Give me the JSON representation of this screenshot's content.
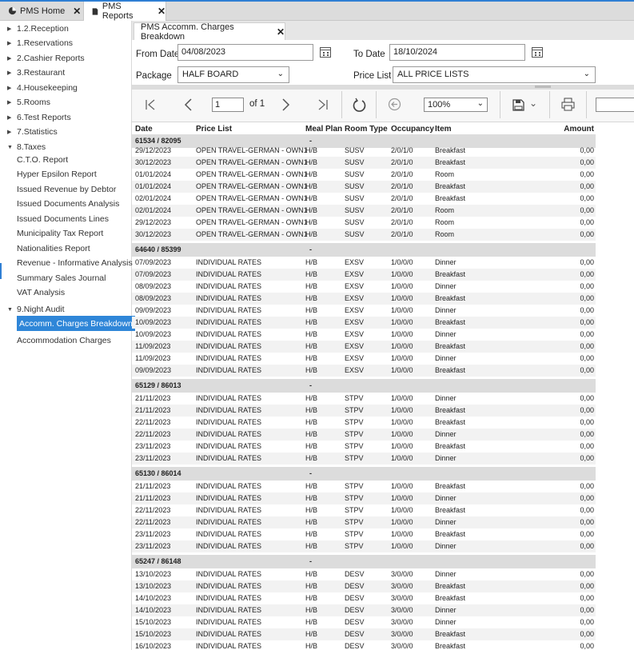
{
  "app_tabs": [
    {
      "label": "PMS Home",
      "close": "✕"
    },
    {
      "label": "PMS Reports",
      "close": "✕"
    }
  ],
  "sidebar": {
    "groups": [
      {
        "label": "1.2.Reception"
      },
      {
        "label": "1.Reservations"
      },
      {
        "label": "2.Cashier Reports"
      },
      {
        "label": "3.Restaurant"
      },
      {
        "label": "4.Housekeeping"
      },
      {
        "label": "5.Rooms"
      },
      {
        "label": "6.Test Reports"
      },
      {
        "label": "7.Statistics"
      },
      {
        "label": "8.Taxes"
      }
    ],
    "taxes_items": [
      "C.T.O. Report",
      "Hyper Epsilon Report",
      "Issued Revenue by Debtor",
      "Issued Documents Analysis",
      "Issued Documents Lines",
      "Municipality Tax Report",
      "Nationalities Report",
      "Revenue - Informative Analysis",
      "Summary Sales Journal",
      "VAT Analysis"
    ],
    "night_audit": {
      "label": "9.Night Audit"
    },
    "night_audit_items": [
      "Accomm. Charges Breakdown",
      "Accommodation Charges"
    ]
  },
  "report_tab": {
    "label": "PMS Accomm. Charges Breakdown",
    "close": "✕"
  },
  "filters": {
    "from_date_label": "From Date",
    "from_date": "04/08/2023",
    "to_date_label": "To Date",
    "to_date": "18/10/2024",
    "package_label": "Package",
    "package": "HALF BOARD",
    "price_list_label": "Price List",
    "price_list": "ALL PRICE LISTS"
  },
  "toolbar": {
    "page": "1",
    "of_label": "of 1",
    "zoom": "100%"
  },
  "columns": {
    "date": "Date",
    "price_list": "Price List",
    "meal_plan": "Meal Plan",
    "room_type": "Room Type",
    "occupancy": "Occupancy",
    "item": "Item",
    "amount": "Amount"
  },
  "groups": [
    {
      "header": "61534 /  82095",
      "dash": "-",
      "rows": [
        [
          "29/12/2023",
          "OPEN TRAVEL-GERMAN - OWN1",
          "H/B",
          "SUSV",
          "2/0/1/0",
          "Breakfast",
          "0,00"
        ],
        [
          "30/12/2023",
          "OPEN TRAVEL-GERMAN - OWN1",
          "H/B",
          "SUSV",
          "2/0/1/0",
          "Breakfast",
          "0,00"
        ],
        [
          "01/01/2024",
          "OPEN TRAVEL-GERMAN - OWN1",
          "H/B",
          "SUSV",
          "2/0/1/0",
          "Room",
          "0,00"
        ],
        [
          "01/01/2024",
          "OPEN TRAVEL-GERMAN - OWN1",
          "H/B",
          "SUSV",
          "2/0/1/0",
          "Breakfast",
          "0,00"
        ],
        [
          "02/01/2024",
          "OPEN TRAVEL-GERMAN - OWN1",
          "H/B",
          "SUSV",
          "2/0/1/0",
          "Breakfast",
          "0,00"
        ],
        [
          "02/01/2024",
          "OPEN TRAVEL-GERMAN - OWN1",
          "H/B",
          "SUSV",
          "2/0/1/0",
          "Room",
          "0,00"
        ],
        [
          "29/12/2023",
          "OPEN TRAVEL-GERMAN - OWN1",
          "H/B",
          "SUSV",
          "2/0/1/0",
          "Room",
          "0,00"
        ],
        [
          "30/12/2023",
          "OPEN TRAVEL-GERMAN - OWN1",
          "H/B",
          "SUSV",
          "2/0/1/0",
          "Room",
          "0,00"
        ]
      ]
    },
    {
      "header": "64640 /  85399",
      "dash": "-",
      "rows": [
        [
          "07/09/2023",
          "INDIVIDUAL RATES",
          "H/B",
          "EXSV",
          "1/0/0/0",
          "Dinner",
          "0,00"
        ],
        [
          "07/09/2023",
          "INDIVIDUAL RATES",
          "H/B",
          "EXSV",
          "1/0/0/0",
          "Breakfast",
          "0,00"
        ],
        [
          "08/09/2023",
          "INDIVIDUAL RATES",
          "H/B",
          "EXSV",
          "1/0/0/0",
          "Dinner",
          "0,00"
        ],
        [
          "08/09/2023",
          "INDIVIDUAL RATES",
          "H/B",
          "EXSV",
          "1/0/0/0",
          "Breakfast",
          "0,00"
        ],
        [
          "09/09/2023",
          "INDIVIDUAL RATES",
          "H/B",
          "EXSV",
          "1/0/0/0",
          "Dinner",
          "0,00"
        ],
        [
          "10/09/2023",
          "INDIVIDUAL RATES",
          "H/B",
          "EXSV",
          "1/0/0/0",
          "Breakfast",
          "0,00"
        ],
        [
          "10/09/2023",
          "INDIVIDUAL RATES",
          "H/B",
          "EXSV",
          "1/0/0/0",
          "Dinner",
          "0,00"
        ],
        [
          "11/09/2023",
          "INDIVIDUAL RATES",
          "H/B",
          "EXSV",
          "1/0/0/0",
          "Breakfast",
          "0,00"
        ],
        [
          "11/09/2023",
          "INDIVIDUAL RATES",
          "H/B",
          "EXSV",
          "1/0/0/0",
          "Dinner",
          "0,00"
        ],
        [
          "09/09/2023",
          "INDIVIDUAL RATES",
          "H/B",
          "EXSV",
          "1/0/0/0",
          "Breakfast",
          "0,00"
        ]
      ]
    },
    {
      "header": "65129 /  86013",
      "dash": "-",
      "rows": [
        [
          "21/11/2023",
          "INDIVIDUAL RATES",
          "H/B",
          "STPV",
          "1/0/0/0",
          "Dinner",
          "0,00"
        ],
        [
          "21/11/2023",
          "INDIVIDUAL RATES",
          "H/B",
          "STPV",
          "1/0/0/0",
          "Breakfast",
          "0,00"
        ],
        [
          "22/11/2023",
          "INDIVIDUAL RATES",
          "H/B",
          "STPV",
          "1/0/0/0",
          "Breakfast",
          "0,00"
        ],
        [
          "22/11/2023",
          "INDIVIDUAL RATES",
          "H/B",
          "STPV",
          "1/0/0/0",
          "Dinner",
          "0,00"
        ],
        [
          "23/11/2023",
          "INDIVIDUAL RATES",
          "H/B",
          "STPV",
          "1/0/0/0",
          "Breakfast",
          "0,00"
        ],
        [
          "23/11/2023",
          "INDIVIDUAL RATES",
          "H/B",
          "STPV",
          "1/0/0/0",
          "Dinner",
          "0,00"
        ]
      ]
    },
    {
      "header": "65130 /  86014",
      "dash": "-",
      "rows": [
        [
          "21/11/2023",
          "INDIVIDUAL RATES",
          "H/B",
          "STPV",
          "1/0/0/0",
          "Breakfast",
          "0,00"
        ],
        [
          "21/11/2023",
          "INDIVIDUAL RATES",
          "H/B",
          "STPV",
          "1/0/0/0",
          "Dinner",
          "0,00"
        ],
        [
          "22/11/2023",
          "INDIVIDUAL RATES",
          "H/B",
          "STPV",
          "1/0/0/0",
          "Breakfast",
          "0,00"
        ],
        [
          "22/11/2023",
          "INDIVIDUAL RATES",
          "H/B",
          "STPV",
          "1/0/0/0",
          "Dinner",
          "0,00"
        ],
        [
          "23/11/2023",
          "INDIVIDUAL RATES",
          "H/B",
          "STPV",
          "1/0/0/0",
          "Breakfast",
          "0,00"
        ],
        [
          "23/11/2023",
          "INDIVIDUAL RATES",
          "H/B",
          "STPV",
          "1/0/0/0",
          "Dinner",
          "0,00"
        ]
      ]
    },
    {
      "header": "65247 /  86148",
      "dash": "-",
      "rows": [
        [
          "13/10/2023",
          "INDIVIDUAL RATES",
          "H/B",
          "DESV",
          "3/0/0/0",
          "Dinner",
          "0,00"
        ],
        [
          "13/10/2023",
          "INDIVIDUAL RATES",
          "H/B",
          "DESV",
          "3/0/0/0",
          "Breakfast",
          "0,00"
        ],
        [
          "14/10/2023",
          "INDIVIDUAL RATES",
          "H/B",
          "DESV",
          "3/0/0/0",
          "Breakfast",
          "0,00"
        ],
        [
          "14/10/2023",
          "INDIVIDUAL RATES",
          "H/B",
          "DESV",
          "3/0/0/0",
          "Dinner",
          "0,00"
        ],
        [
          "15/10/2023",
          "INDIVIDUAL RATES",
          "H/B",
          "DESV",
          "3/0/0/0",
          "Dinner",
          "0,00"
        ],
        [
          "15/10/2023",
          "INDIVIDUAL RATES",
          "H/B",
          "DESV",
          "3/0/0/0",
          "Breakfast",
          "0,00"
        ],
        [
          "16/10/2023",
          "INDIVIDUAL RATES",
          "H/B",
          "DESV",
          "3/0/0/0",
          "Breakfast",
          "0,00"
        ]
      ]
    }
  ],
  "colors": {
    "accent": "#2f86d8",
    "group_bg": "#dcdcdc",
    "alt_row": "#f2f2f2"
  }
}
